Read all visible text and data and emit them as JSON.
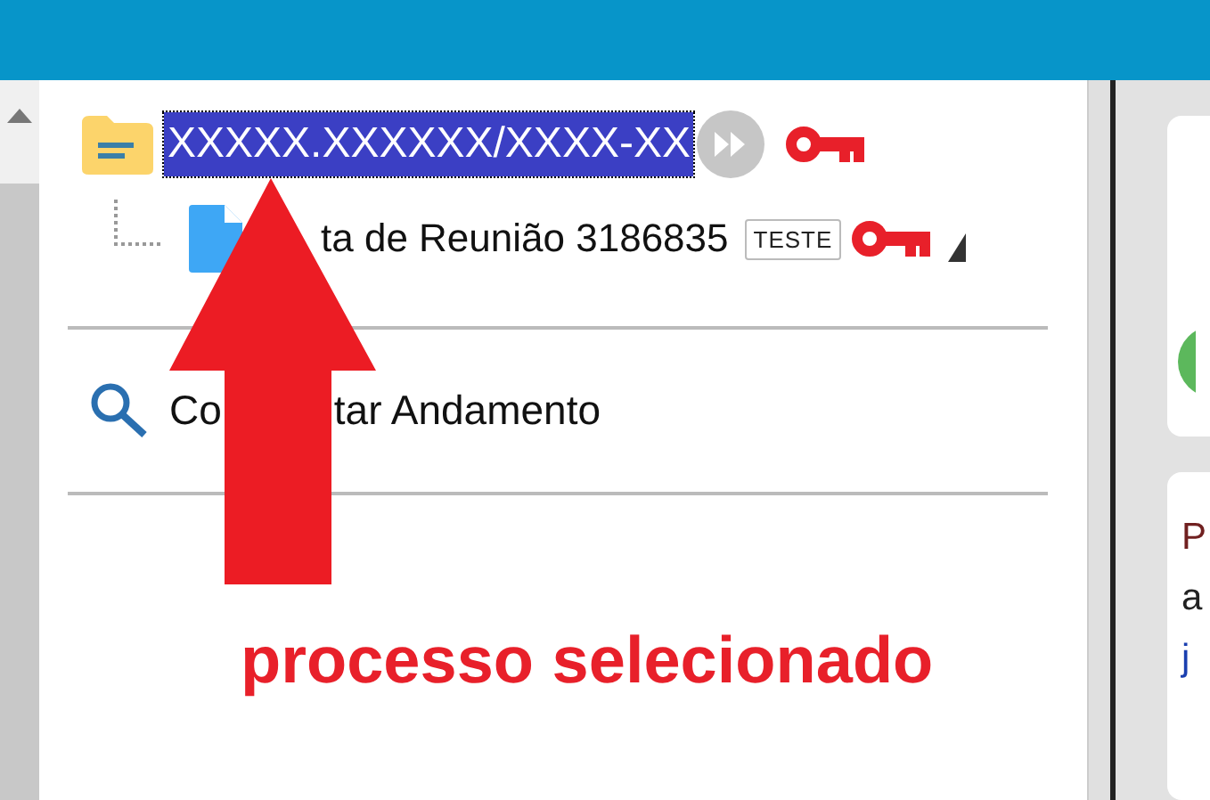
{
  "tree": {
    "process": {
      "number": "XXXXX.XXXXXX/XXXX-XX",
      "selected": true
    },
    "documents": [
      {
        "title": "ta de Reunião 3186835",
        "tag": "TESTE"
      }
    ]
  },
  "actions": [
    {
      "label_start": "Co",
      "label_end": "tar Andamento"
    }
  ],
  "annotation": {
    "text": "processo selecionado"
  },
  "side_card": {
    "lines": [
      {
        "text": "P",
        "kind": "plain"
      },
      {
        "text": "a",
        "kind": "plain"
      },
      {
        "text": "j",
        "kind": "link"
      }
    ]
  }
}
